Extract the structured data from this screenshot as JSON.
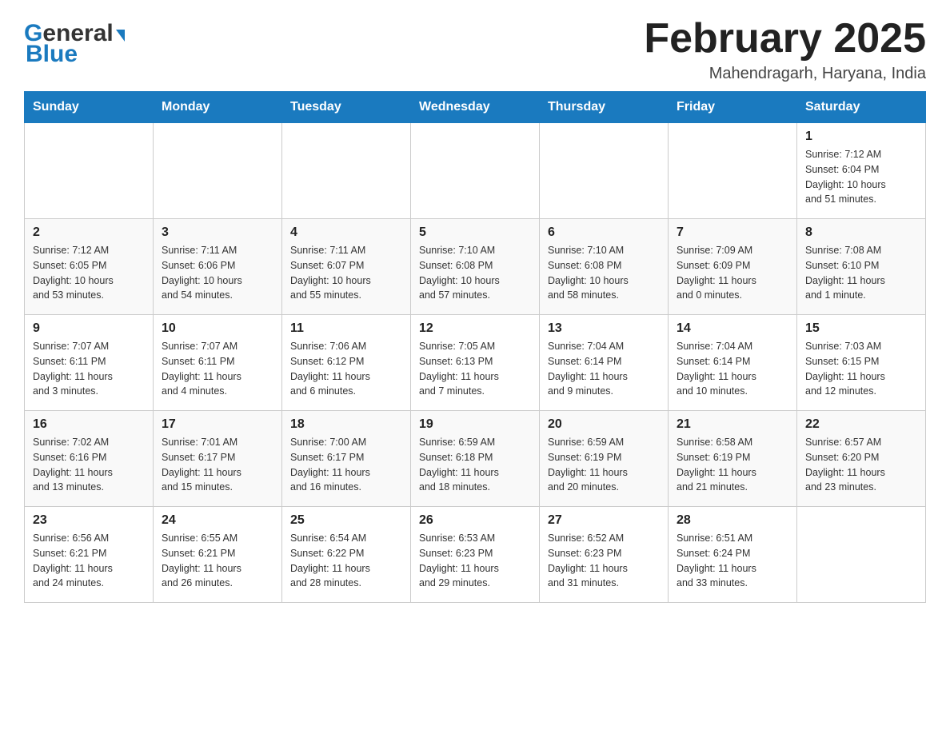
{
  "header": {
    "logo_general": "General",
    "logo_blue": "Blue",
    "month_title": "February 2025",
    "location": "Mahendragarh, Haryana, India"
  },
  "days_of_week": [
    "Sunday",
    "Monday",
    "Tuesday",
    "Wednesday",
    "Thursday",
    "Friday",
    "Saturday"
  ],
  "weeks": [
    [
      {
        "day": "",
        "info": ""
      },
      {
        "day": "",
        "info": ""
      },
      {
        "day": "",
        "info": ""
      },
      {
        "day": "",
        "info": ""
      },
      {
        "day": "",
        "info": ""
      },
      {
        "day": "",
        "info": ""
      },
      {
        "day": "1",
        "info": "Sunrise: 7:12 AM\nSunset: 6:04 PM\nDaylight: 10 hours\nand 51 minutes."
      }
    ],
    [
      {
        "day": "2",
        "info": "Sunrise: 7:12 AM\nSunset: 6:05 PM\nDaylight: 10 hours\nand 53 minutes."
      },
      {
        "day": "3",
        "info": "Sunrise: 7:11 AM\nSunset: 6:06 PM\nDaylight: 10 hours\nand 54 minutes."
      },
      {
        "day": "4",
        "info": "Sunrise: 7:11 AM\nSunset: 6:07 PM\nDaylight: 10 hours\nand 55 minutes."
      },
      {
        "day": "5",
        "info": "Sunrise: 7:10 AM\nSunset: 6:08 PM\nDaylight: 10 hours\nand 57 minutes."
      },
      {
        "day": "6",
        "info": "Sunrise: 7:10 AM\nSunset: 6:08 PM\nDaylight: 10 hours\nand 58 minutes."
      },
      {
        "day": "7",
        "info": "Sunrise: 7:09 AM\nSunset: 6:09 PM\nDaylight: 11 hours\nand 0 minutes."
      },
      {
        "day": "8",
        "info": "Sunrise: 7:08 AM\nSunset: 6:10 PM\nDaylight: 11 hours\nand 1 minute."
      }
    ],
    [
      {
        "day": "9",
        "info": "Sunrise: 7:07 AM\nSunset: 6:11 PM\nDaylight: 11 hours\nand 3 minutes."
      },
      {
        "day": "10",
        "info": "Sunrise: 7:07 AM\nSunset: 6:11 PM\nDaylight: 11 hours\nand 4 minutes."
      },
      {
        "day": "11",
        "info": "Sunrise: 7:06 AM\nSunset: 6:12 PM\nDaylight: 11 hours\nand 6 minutes."
      },
      {
        "day": "12",
        "info": "Sunrise: 7:05 AM\nSunset: 6:13 PM\nDaylight: 11 hours\nand 7 minutes."
      },
      {
        "day": "13",
        "info": "Sunrise: 7:04 AM\nSunset: 6:14 PM\nDaylight: 11 hours\nand 9 minutes."
      },
      {
        "day": "14",
        "info": "Sunrise: 7:04 AM\nSunset: 6:14 PM\nDaylight: 11 hours\nand 10 minutes."
      },
      {
        "day": "15",
        "info": "Sunrise: 7:03 AM\nSunset: 6:15 PM\nDaylight: 11 hours\nand 12 minutes."
      }
    ],
    [
      {
        "day": "16",
        "info": "Sunrise: 7:02 AM\nSunset: 6:16 PM\nDaylight: 11 hours\nand 13 minutes."
      },
      {
        "day": "17",
        "info": "Sunrise: 7:01 AM\nSunset: 6:17 PM\nDaylight: 11 hours\nand 15 minutes."
      },
      {
        "day": "18",
        "info": "Sunrise: 7:00 AM\nSunset: 6:17 PM\nDaylight: 11 hours\nand 16 minutes."
      },
      {
        "day": "19",
        "info": "Sunrise: 6:59 AM\nSunset: 6:18 PM\nDaylight: 11 hours\nand 18 minutes."
      },
      {
        "day": "20",
        "info": "Sunrise: 6:59 AM\nSunset: 6:19 PM\nDaylight: 11 hours\nand 20 minutes."
      },
      {
        "day": "21",
        "info": "Sunrise: 6:58 AM\nSunset: 6:19 PM\nDaylight: 11 hours\nand 21 minutes."
      },
      {
        "day": "22",
        "info": "Sunrise: 6:57 AM\nSunset: 6:20 PM\nDaylight: 11 hours\nand 23 minutes."
      }
    ],
    [
      {
        "day": "23",
        "info": "Sunrise: 6:56 AM\nSunset: 6:21 PM\nDaylight: 11 hours\nand 24 minutes."
      },
      {
        "day": "24",
        "info": "Sunrise: 6:55 AM\nSunset: 6:21 PM\nDaylight: 11 hours\nand 26 minutes."
      },
      {
        "day": "25",
        "info": "Sunrise: 6:54 AM\nSunset: 6:22 PM\nDaylight: 11 hours\nand 28 minutes."
      },
      {
        "day": "26",
        "info": "Sunrise: 6:53 AM\nSunset: 6:23 PM\nDaylight: 11 hours\nand 29 minutes."
      },
      {
        "day": "27",
        "info": "Sunrise: 6:52 AM\nSunset: 6:23 PM\nDaylight: 11 hours\nand 31 minutes."
      },
      {
        "day": "28",
        "info": "Sunrise: 6:51 AM\nSunset: 6:24 PM\nDaylight: 11 hours\nand 33 minutes."
      },
      {
        "day": "",
        "info": ""
      }
    ]
  ]
}
